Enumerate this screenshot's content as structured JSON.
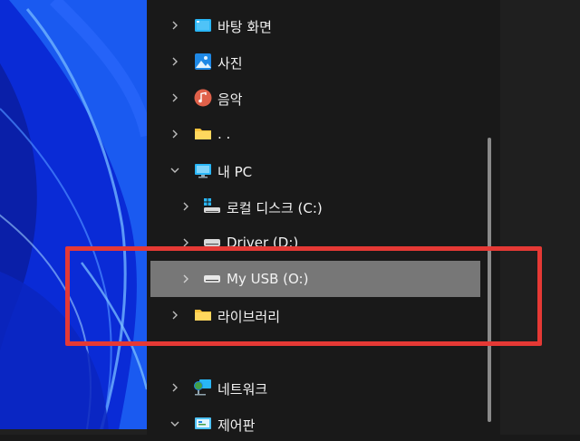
{
  "colors": {
    "accent_highlight": "#e53935",
    "selection_bg": "#777777",
    "panel_bg": "#191919",
    "wallpaper_blue": "#0a2bd6"
  },
  "nav": {
    "items": [
      {
        "label": "바탕 화면",
        "icon": "desktop-icon",
        "expanded": false
      },
      {
        "label": "사진",
        "icon": "pictures-icon",
        "expanded": false
      },
      {
        "label": "음악",
        "icon": "music-icon",
        "expanded": false
      },
      {
        "label": ". .",
        "icon": "folder-icon",
        "expanded": false
      },
      {
        "label": "내 PC",
        "icon": "this-pc-icon",
        "expanded": true
      },
      {
        "label": "로컬 디스크 (C:)",
        "icon": "system-drive-icon",
        "expanded": false
      },
      {
        "label": "Driver (D:)",
        "icon": "drive-icon",
        "expanded": false
      },
      {
        "label": "My USB (O:)",
        "icon": "usb-drive-icon",
        "expanded": false,
        "selected": true
      },
      {
        "label": "라이브러리",
        "icon": "library-folder-icon",
        "expanded": false
      },
      {
        "label": "네트워크",
        "icon": "network-icon",
        "expanded": false
      },
      {
        "label": "제어판",
        "icon": "control-panel-icon",
        "expanded": true
      }
    ]
  }
}
